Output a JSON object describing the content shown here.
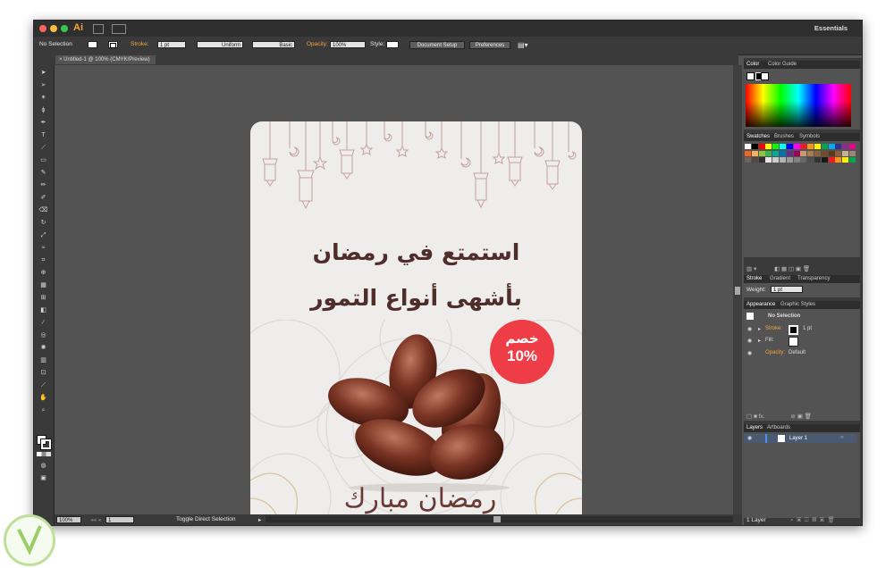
{
  "app": {
    "logo": "Ai",
    "workspace": "Essentials"
  },
  "control_bar": {
    "selection": "No Selection",
    "stroke_label": "Stroke:",
    "stroke_weight": "1 pt",
    "stroke_profile": "Uniform",
    "brush": "Basic",
    "opacity_label": "Opacity:",
    "opacity_value": "100%",
    "style_label": "Style:",
    "document_setup": "Document Setup",
    "preferences": "Preferences"
  },
  "document": {
    "tab_title": "Untitled-1 @ 100% (CMYK/Preview)"
  },
  "artwork": {
    "line1": "استمتع في رمضان",
    "line2": "بأشهى أنواع التمور",
    "badge_top": "خصم",
    "badge_pct": "10%",
    "greeting": "رمضان مبارك",
    "colors": {
      "bg": "#efedec",
      "text": "#4f2d2a",
      "badge": "#ef3d47",
      "ornament": "#c4a19b"
    }
  },
  "panels": {
    "color": {
      "tab_color": "Color",
      "tab_guide": "Color Guide"
    },
    "swatches": {
      "tab_swatches": "Swatches",
      "tab_brushes": "Brushes",
      "tab_symbols": "Symbols"
    },
    "stroke": {
      "tab_stroke": "Stroke",
      "tab_gradient": "Gradient",
      "tab_transparency": "Transparency",
      "weight_label": "Weight:",
      "weight_value": "1 pt"
    },
    "appearance": {
      "tab_appearance": "Appearance",
      "tab_graphic_styles": "Graphic Styles",
      "title": "No Selection",
      "stroke_label": "Stroke:",
      "stroke_value": "1 pt",
      "fill_label": "Fill:",
      "opacity_label": "Opacity:",
      "opacity_value": "Default"
    },
    "layers": {
      "tab_layers": "Layers",
      "tab_artboards": "Artboards",
      "layer_name": "Layer 1",
      "footer": "1 Layer"
    }
  },
  "status_bar": {
    "zoom": "100%",
    "artboard_num": "1",
    "status_text": "Toggle Direct Selection"
  },
  "swatch_colors": [
    "#ffffff",
    "#000000",
    "#ff0000",
    "#ffff00",
    "#00ff00",
    "#00ffff",
    "#0000ff",
    "#ff00ff",
    "#ed1c24",
    "#f7941d",
    "#fff200",
    "#00a651",
    "#00aeef",
    "#2e3192",
    "#92278f",
    "#ec008c",
    "#f26522",
    "#fbaf5d",
    "#8dc63f",
    "#39b54a",
    "#00a99d",
    "#0072bc",
    "#662d91",
    "#9e005d",
    "#c69c6d",
    "#a67c52",
    "#8c6239",
    "#754c24",
    "#603913",
    "#8b5e3c",
    "#c7b299",
    "#998675",
    "#736357",
    "#534741",
    "#362f2d",
    "#e6e6e6",
    "#cccccc",
    "#b3b3b3",
    "#999999",
    "#808080",
    "#666666",
    "#4d4d4d",
    "#333333",
    "#1a1a1a",
    "#ed1c24",
    "#f7941d",
    "#fff200",
    "#00a651"
  ]
}
